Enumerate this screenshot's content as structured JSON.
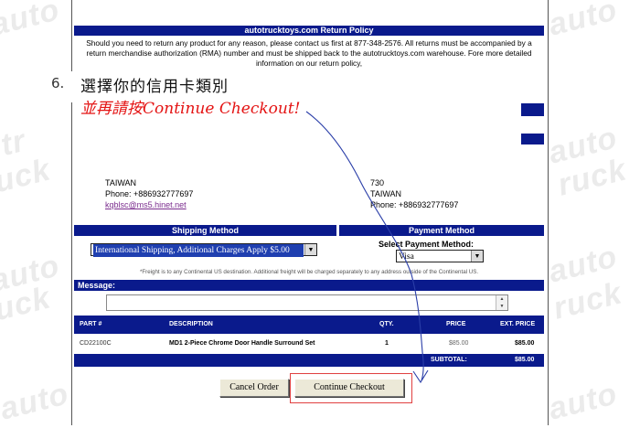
{
  "return_policy": {
    "title": "autotrucktoys.com Return Policy",
    "text": "Should you need to return any product for any reason, please contact us first at 877-348-2576. All returns must be accompanied by a return merchandise authorization (RMA) number and must be shipped back to the autotrucktoys.com warehouse. Fore more detailed information on our return policy,"
  },
  "instruction": {
    "step": "6.",
    "line1": "選擇你的信用卡類別",
    "line2": "並再請按Continue Checkout!"
  },
  "address_left": {
    "country": "TAIWAN",
    "phone": "Phone: +886932777697",
    "email": "kqblsc@ms5.hinet.net"
  },
  "address_right": {
    "zip": "730",
    "country": "TAIWAN",
    "phone": "Phone: +886932777697"
  },
  "shipping": {
    "header": "Shipping Method",
    "selected": "International Shipping, Additional Charges Apply $5.00"
  },
  "payment": {
    "header": "Payment Method",
    "label": "Select Payment Method:",
    "selected": "Visa"
  },
  "freight_note": "*Freight is to any Continental US destination. Additional freight will be charged separately to any address outside of the Continental US.",
  "message": {
    "label": "Message:"
  },
  "order_table": {
    "headers": [
      "PART #",
      "DESCRIPTION",
      "QTY.",
      "PRICE",
      "EXT. PRICE"
    ],
    "rows": [
      {
        "part": "CD22100C",
        "description": "MD1 2-Piece Chrome Door Handle Surround Set",
        "qty": "1",
        "price": "$85.00",
        "ext_price": "$85.00"
      }
    ],
    "subtotal_label": "SUBTOTAL:",
    "subtotal_value": "$85.00"
  },
  "buttons": {
    "cancel": "Cancel Order",
    "continue": "Continue Checkout"
  },
  "colors": {
    "navy": "#0a1a8c",
    "annotation_red": "#e41313",
    "arrow_blue": "#2a3ea8"
  }
}
